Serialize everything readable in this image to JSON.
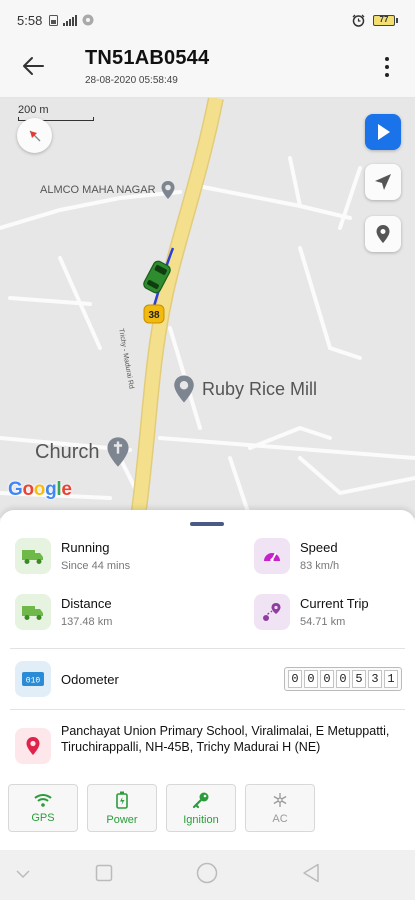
{
  "status_bar": {
    "time": "5:58",
    "battery": "77"
  },
  "header": {
    "title": "TN51AB0544",
    "subtitle": "28-08-2020 05:58:49"
  },
  "map": {
    "scale_label": "200 m",
    "road_shield": "38",
    "road_name": "Trichy - Madurai Rd",
    "pois": {
      "almco": "ALMCO MAHA NAGAR",
      "ruby": "Ruby Rice Mill",
      "church": "Church"
    },
    "attribution": "Google",
    "vehicle_color": "#2e8b2e"
  },
  "stats": {
    "status": {
      "label": "Running",
      "sub": "Since 44 mins"
    },
    "speed": {
      "label": "Speed",
      "sub": "83 km/h"
    },
    "distance": {
      "label": "Distance",
      "sub": "137.48 km"
    },
    "trip": {
      "label": "Current Trip",
      "sub": "54.71 km"
    }
  },
  "odometer": {
    "label": "Odometer",
    "digits": [
      "0",
      "0",
      "0",
      "0",
      "5",
      "3",
      "1"
    ]
  },
  "address": "Panchayat Union Primary School, Viralimalai, E Metuppatti, Tiruchirappalli, NH-45B, Trichy Madurai H (NE)",
  "indicators": {
    "gps": "GPS",
    "power": "Power",
    "ignition": "Ignition",
    "ac": "AC"
  },
  "colors": {
    "accent": "#1a73e8",
    "active_green": "#2a9d3a",
    "inactive_gray": "#9a9a9a",
    "speed_magenta": "#c423c9",
    "location_red": "#e0234a"
  },
  "icons": {
    "back": "arrow-left-icon",
    "menu": "more-vert-icon",
    "compass": "compass-icon",
    "play": "play-icon",
    "navigate": "navigation-icon",
    "pin": "location-pin-icon",
    "truck": "truck-icon",
    "speedometer": "speedometer-icon",
    "route": "route-icon",
    "odometer": "odometer-icon",
    "gps": "wifi-signal-icon",
    "power": "battery-icon",
    "ignition": "key-icon",
    "ac": "snowflake-icon"
  }
}
